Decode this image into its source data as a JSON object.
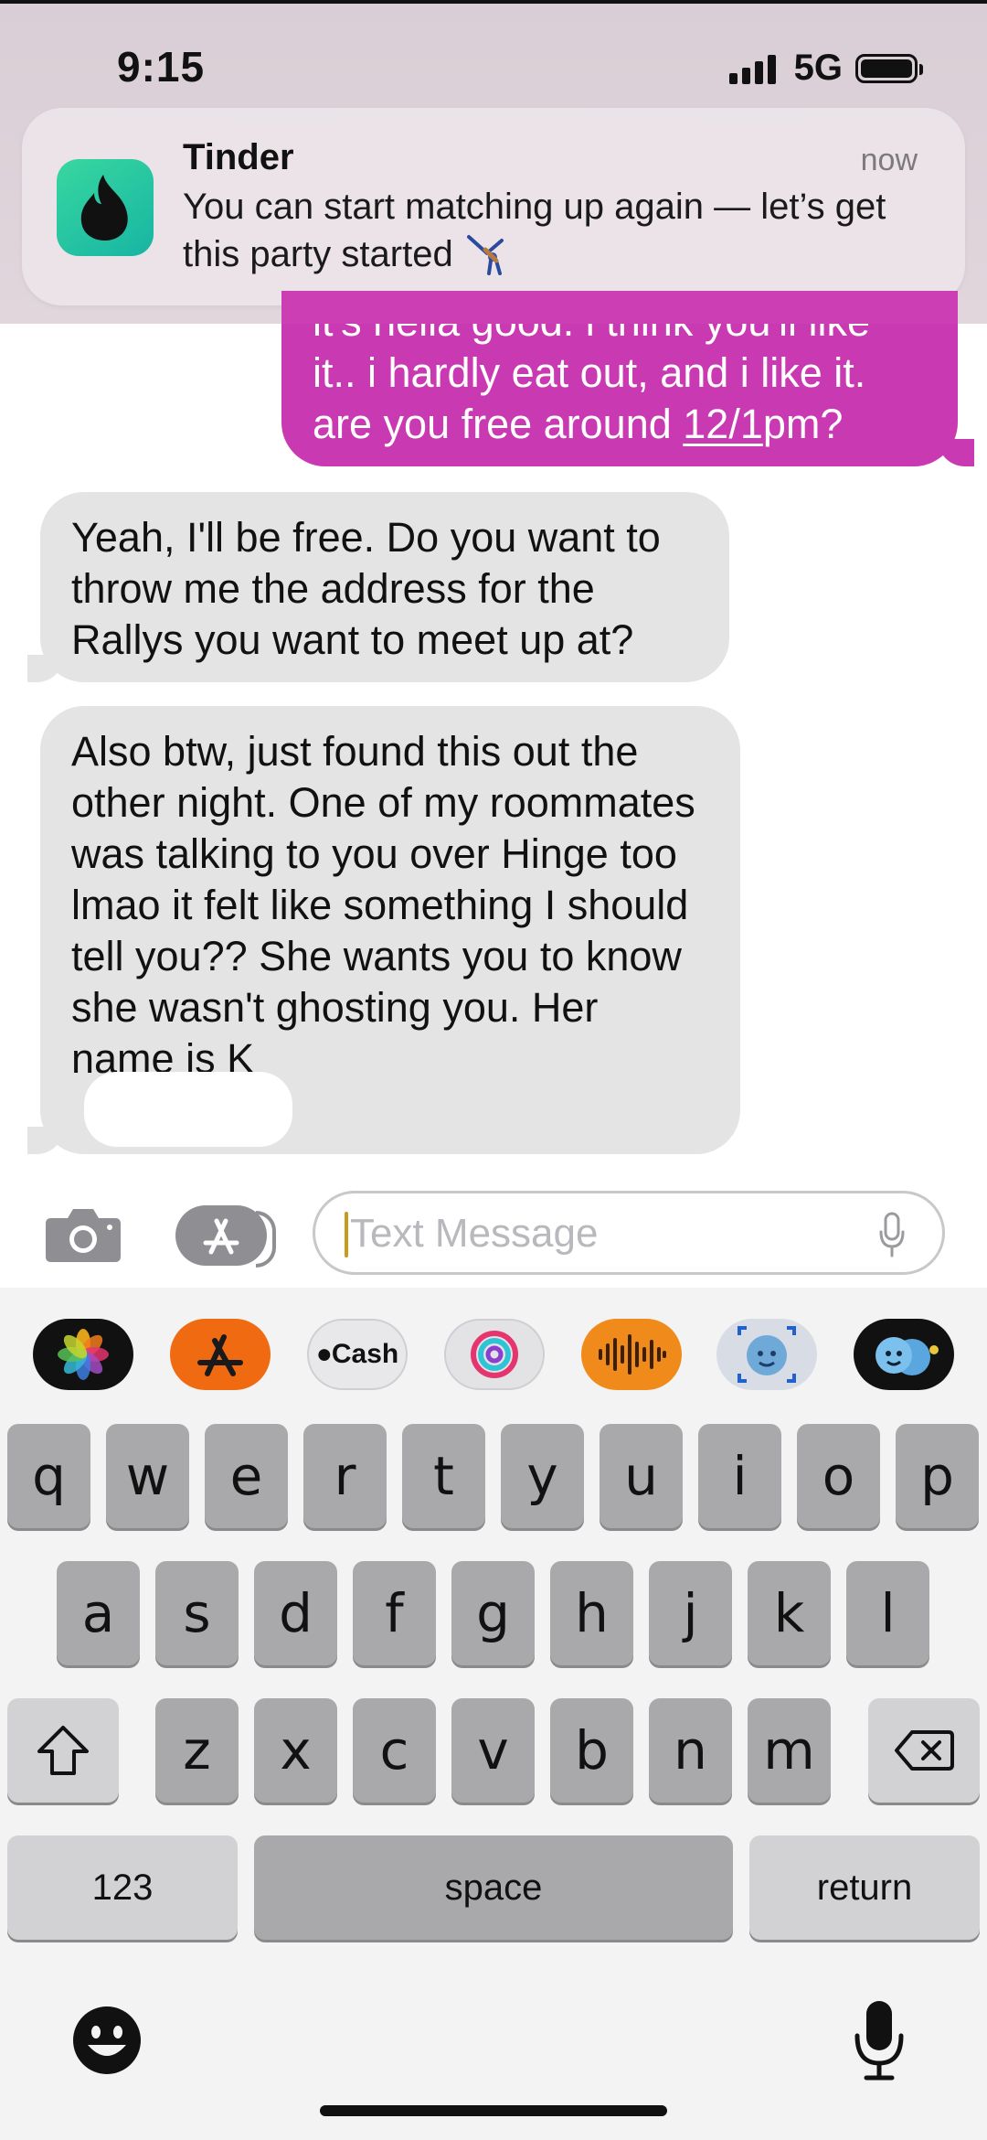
{
  "status_bar": {
    "time": "9:15",
    "network": "5G",
    "battery_level": 1.0
  },
  "notification": {
    "app": "Tinder",
    "time": "now",
    "body": "You can start matching up again — let’s get this party started",
    "icon": "tinder-flame-icon",
    "trailing_emoji": "person-doing-cartwheel-icon"
  },
  "messages": {
    "sent_1": {
      "partial_line": "it's hella good. i think you'll like",
      "line1": "it.. i hardly eat out, and i like it.",
      "line2_prefix": "are you free around ",
      "line2_link": "12/1",
      "line2_suffix": "pm?"
    },
    "received_1": "Yeah, I'll be free. Do you want to throw me the address for the Rallys you want to meet up at?",
    "received_2": "Also btw, just found this out the other night. One of my roommates was talking to you over Hinge too lmao it felt like something I should tell you?? She wants you to know she wasn't ghosting you. Her name is K"
  },
  "compose": {
    "placeholder": "Text Message",
    "value": "",
    "camera_icon": "camera-icon",
    "apps_icon": "app-store-icon",
    "mic_icon": "microphone-icon"
  },
  "app_strip": [
    {
      "name": "photos-icon",
      "color": "#111111"
    },
    {
      "name": "app-store-icon",
      "color": "#f06a12"
    },
    {
      "name": "apple-cash-icon",
      "label": "Cash",
      "color": "#e8e8ea"
    },
    {
      "name": "activity-icon",
      "color": "#e3e3e5"
    },
    {
      "name": "audio-message-icon",
      "color": "#f08a1a"
    },
    {
      "name": "memoji-icon",
      "color": "#d8dce4"
    },
    {
      "name": "memoji-stickers-icon",
      "color": "#111111"
    }
  ],
  "keyboard": {
    "row1": [
      "q",
      "w",
      "e",
      "r",
      "t",
      "y",
      "u",
      "i",
      "o",
      "p"
    ],
    "row2": [
      "a",
      "s",
      "d",
      "f",
      "g",
      "h",
      "j",
      "k",
      "l"
    ],
    "row3": [
      "z",
      "x",
      "c",
      "v",
      "b",
      "n",
      "m"
    ],
    "numbers": "123",
    "space": "space",
    "return": "return",
    "shift_icon": "shift-icon",
    "delete_icon": "delete-icon",
    "emoji_icon": "emoji-icon",
    "dictation_icon": "microphone-icon"
  }
}
